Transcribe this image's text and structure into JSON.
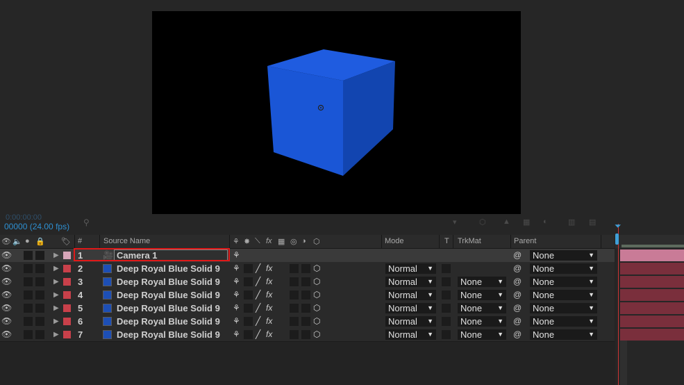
{
  "toolbar": {
    "timecode_ghost": "0:00:00:00",
    "fps": "00000 (24.00 fps)"
  },
  "columns": {
    "num": "#",
    "source_name": "Source Name",
    "mode": "Mode",
    "t": "T",
    "trkmat": "TrkMat",
    "parent": "Parent"
  },
  "layers": [
    {
      "num": "1",
      "name": "Camera 1",
      "type": "camera",
      "label_color": "#d7a6b9",
      "mode": "",
      "trkmat": "",
      "parent": "None"
    },
    {
      "num": "2",
      "name": "Deep Royal Blue Solid 9",
      "type": "solid",
      "label_color": "#c8404a",
      "mode": "Normal",
      "trkmat": "",
      "parent": "None"
    },
    {
      "num": "3",
      "name": "Deep Royal Blue Solid 9",
      "type": "solid",
      "label_color": "#c8404a",
      "mode": "Normal",
      "trkmat": "None",
      "parent": "None"
    },
    {
      "num": "4",
      "name": "Deep Royal Blue Solid 9",
      "type": "solid",
      "label_color": "#c8404a",
      "mode": "Normal",
      "trkmat": "None",
      "parent": "None"
    },
    {
      "num": "5",
      "name": "Deep Royal Blue Solid 9",
      "type": "solid",
      "label_color": "#c8404a",
      "mode": "Normal",
      "trkmat": "None",
      "parent": "None"
    },
    {
      "num": "6",
      "name": "Deep Royal Blue Solid 9",
      "type": "solid",
      "label_color": "#c8404a",
      "mode": "Normal",
      "trkmat": "None",
      "parent": "None"
    },
    {
      "num": "7",
      "name": "Deep Royal Blue Solid 9",
      "type": "solid",
      "label_color": "#c8404a",
      "mode": "Normal",
      "trkmat": "None",
      "parent": "None"
    }
  ],
  "colors": {
    "accent": "#2e8fd0",
    "highlight": "#e01818",
    "cube_front": "#1a56d6",
    "cube_side": "#1245b0",
    "cube_top": "#1f5ce0",
    "camera_bar": "#c97b97",
    "solid_bar": "#7a2f3c"
  },
  "icons": {
    "header": [
      "eye-icon",
      "speaker-icon",
      "solo-icon",
      "lock-icon",
      "label-icon",
      "shy-icon",
      "collapse-icon",
      "quality-icon",
      "fx-icon",
      "frame-blend-icon",
      "motion-blur-icon",
      "adjustment-icon",
      "3d-layer-icon"
    ]
  }
}
